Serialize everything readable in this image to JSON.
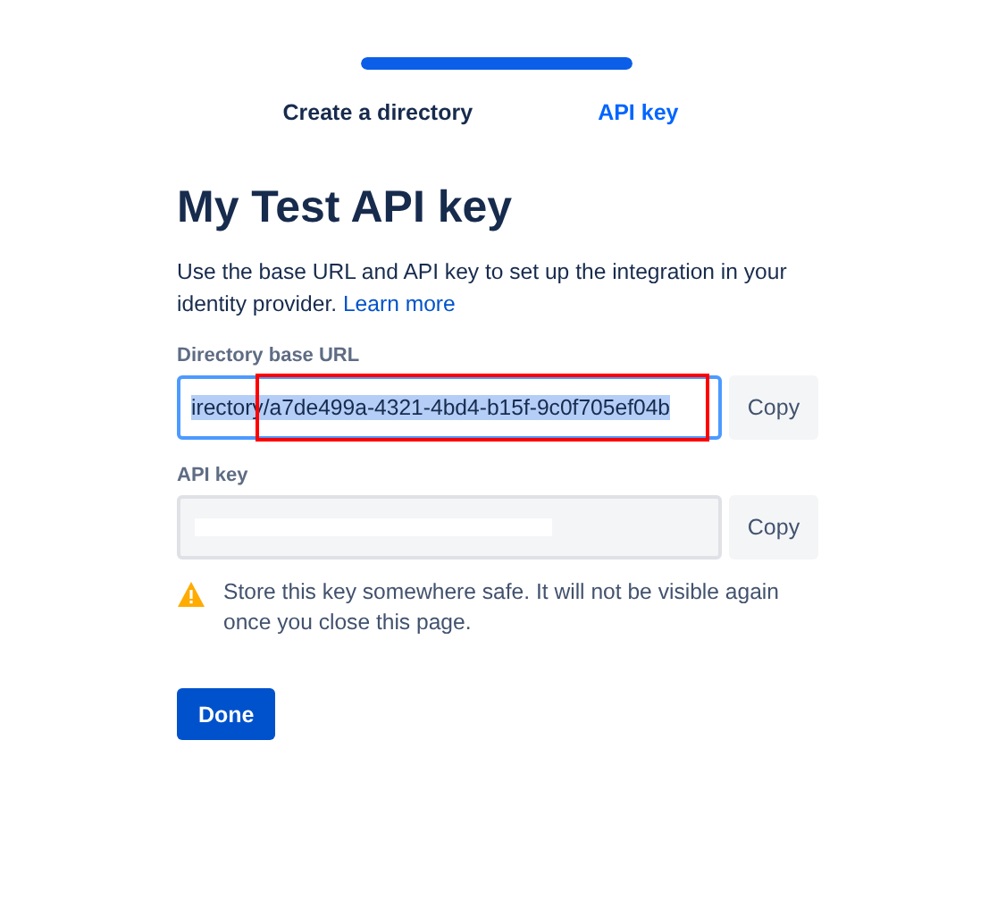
{
  "stepper": {
    "level": 1,
    "steps": [
      {
        "label": "Create a directory",
        "selected": false
      },
      {
        "label": "API key",
        "selected": true
      }
    ]
  },
  "title": "My Test API key",
  "description": "Use the base URL and API key to set up the integration in your identity provider.",
  "link": "Learn more",
  "fields": [
    {
      "label": "Directory base URL",
      "kind": "text",
      "value": "irectory/a7de499a-4321-4bd4-b15f-9c0f705ef04b",
      "focused": true,
      "button": "Copy"
    },
    {
      "label": "API key",
      "kind": "redacted",
      "focused": false,
      "button": "Copy"
    }
  ],
  "warning": "Store this key somewhere safe. It will not be visible again once you close this page.",
  "done_button": "Done"
}
